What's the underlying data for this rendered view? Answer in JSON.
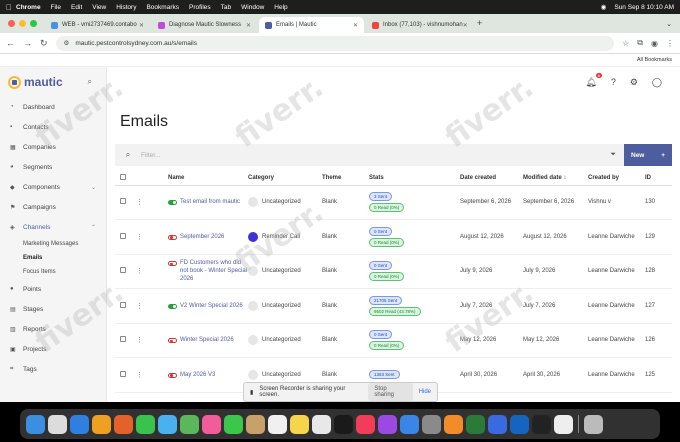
{
  "menubar": {
    "app": "Chrome",
    "items": [
      "File",
      "Edit",
      "View",
      "History",
      "Bookmarks",
      "Profiles",
      "Tab",
      "Window",
      "Help"
    ],
    "datetime": "Sun Sep 8  10:10 AM",
    "assistant": "Ask Gemini"
  },
  "tabs": [
    {
      "title": "WEB - vmi2737469.contabo",
      "color": "#4a90e2"
    },
    {
      "title": "Diagnose Mautic Slowness",
      "color": "#c04bd8"
    },
    {
      "title": "Emails | Mautic",
      "color": "#4e5d9d",
      "active": true
    },
    {
      "title": "Inbox (77,103) - vishnumohan",
      "color": "#e44"
    }
  ],
  "address": {
    "url": "mautic.pestcontrolsydney.com.au/s/emails"
  },
  "bookmarks": {
    "label": "All Bookmarks"
  },
  "logo": {
    "text": "mautic"
  },
  "sidebar": {
    "items": [
      {
        "label": "Dashboard",
        "icon": "dashboard-icon"
      },
      {
        "label": "Contacts",
        "icon": "contacts-icon"
      },
      {
        "label": "Companies",
        "icon": "companies-icon"
      },
      {
        "label": "Segments",
        "icon": "segments-icon"
      },
      {
        "label": "Components",
        "icon": "components-icon"
      },
      {
        "label": "Campaigns",
        "icon": "campaigns-icon"
      },
      {
        "label": "Channels",
        "icon": "channels-icon"
      }
    ],
    "channels_sub": [
      "Marketing Messages",
      "Emails",
      "Focus Items"
    ],
    "items2": [
      {
        "label": "Points",
        "icon": "points-icon"
      },
      {
        "label": "Stages",
        "icon": "stages-icon"
      },
      {
        "label": "Reports",
        "icon": "reports-icon"
      },
      {
        "label": "Projects",
        "icon": "projects-icon"
      },
      {
        "label": "Tags",
        "icon": "tags-icon"
      }
    ]
  },
  "topbar": {
    "notif_count": "8"
  },
  "page": {
    "title": "Emails"
  },
  "toolbar": {
    "filter_placeholder": "Filter...",
    "new_label": "New"
  },
  "table": {
    "headers": {
      "name": "Name",
      "category": "Category",
      "theme": "Theme",
      "stats": "Stats",
      "date_created": "Date created",
      "modified": "Modified date",
      "created_by": "Created by",
      "id": "ID"
    },
    "rows": [
      {
        "name": "Test email from mautic",
        "published": true,
        "category": "Uncategorized",
        "cat_color": "#e6e6e6",
        "theme": "Blank",
        "sent": "3 Sent",
        "read": "0 Read  (0%)",
        "date_created": "September 6, 2026",
        "modified": "September 6, 2026",
        "created_by": "Vishnu v",
        "id": "130"
      },
      {
        "name": "September 2026",
        "published": false,
        "category": "Reminder Call",
        "cat_color": "#3d33d6",
        "theme": "Blank",
        "sent": "0 Sent",
        "read": "0 Read  (0%)",
        "date_created": "August 12, 2026",
        "modified": "August 12, 2026",
        "created_by": "Leanne Darwiche",
        "id": "129"
      },
      {
        "name": "FD Customers who did not book - Winter Special 2026",
        "published": false,
        "category": "Uncategorized",
        "cat_color": "#e6e6e6",
        "theme": "Blank",
        "sent": "0 Sent",
        "read": "0 Read  (0%)",
        "date_created": "July 9, 2026",
        "modified": "July 9, 2026",
        "created_by": "Leanne Darwiche",
        "id": "128"
      },
      {
        "name": "V2 Winter Special 2026",
        "published": true,
        "category": "Uncategorized",
        "cat_color": "#e6e6e6",
        "theme": "Blank",
        "sent": "21705 Sent",
        "read": "9502 Read  (43.78%)",
        "date_created": "July 7, 2026",
        "modified": "July 7, 2026",
        "created_by": "Leanne Darwiche",
        "id": "127"
      },
      {
        "name": "Winter Special 2026",
        "published": false,
        "category": "Uncategorized",
        "cat_color": "#e6e6e6",
        "theme": "Blank",
        "sent": "0 Sent",
        "read": "0 Read  (0%)",
        "date_created": "May 12, 2026",
        "modified": "May 12, 2026",
        "created_by": "Leanne Darwiche",
        "id": "126"
      },
      {
        "name": "May 2026 V3",
        "published": false,
        "category": "Uncategorized",
        "cat_color": "#e6e6e6",
        "theme": "Blank",
        "sent": "1353 Sent",
        "read": "",
        "date_created": "April 30, 2026",
        "modified": "April 30, 2026",
        "created_by": "Leanne Darwiche",
        "id": "125"
      }
    ]
  },
  "recorder": {
    "text": "Screen Recorder is sharing your screen.",
    "stop": "Stop sharing",
    "hide": "Hide"
  },
  "watermark": "fiverr."
}
